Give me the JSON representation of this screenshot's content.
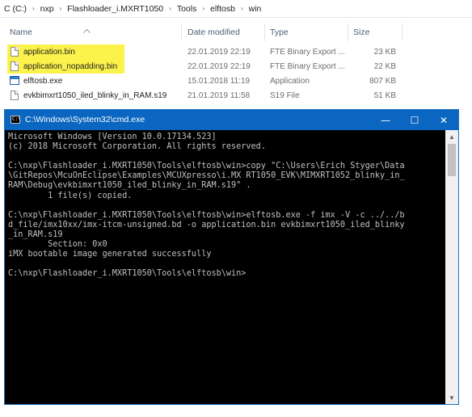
{
  "explorer": {
    "breadcrumb": [
      "C (C:)",
      "nxp",
      "Flashloader_i.MXRT1050",
      "Tools",
      "elftosb",
      "win"
    ],
    "breadcrumb_separator": "›",
    "columns": {
      "name": "Name",
      "date": "Date modified",
      "type": "Type",
      "size": "Size"
    },
    "sort_icon": "sort-up-chevron",
    "files": [
      {
        "name": "application.bin",
        "date": "22.01.2019 22:19",
        "type": "FTE Binary Export ...",
        "size": "23 KB",
        "icon": "file-icon",
        "highlighted": true
      },
      {
        "name": "application_nopadding.bin",
        "date": "22.01.2019 22:19",
        "type": "FTE Binary Export ...",
        "size": "22 KB",
        "icon": "file-icon",
        "highlighted": true
      },
      {
        "name": "elftosb.exe",
        "date": "15.01.2018 11:19",
        "type": "Application",
        "size": "807 KB",
        "icon": "exe-icon",
        "highlighted": false
      },
      {
        "name": "evkbimxrt1050_iled_blinky_in_RAM.s19",
        "date": "21.01.2019 11:58",
        "type": "S19 File",
        "size": "51 KB",
        "icon": "file-icon",
        "highlighted": false
      }
    ],
    "highlight_color": "#fbf24b"
  },
  "cmd": {
    "title": "C:\\Windows\\System32\\cmd.exe",
    "icon_label": "C:\\",
    "buttons": {
      "minimize": "—",
      "maximize": "☐",
      "close": "✕"
    },
    "titlebar_color": "#0a66c0",
    "lines": [
      "Microsoft Windows [Version 10.0.17134.523]",
      "(c) 2018 Microsoft Corporation. All rights reserved.",
      "",
      "C:\\nxp\\Flashloader_i.MXRT1050\\Tools\\elftosb\\win>copy \"C:\\Users\\Erich Styger\\Data",
      "\\GitRepos\\McuOnEclipse\\Examples\\MCUXpresso\\i.MX RT1050_EVK\\MIMXRT1052_blinky_in_",
      "RAM\\Debug\\evkbimxrt1050_iled_blinky_in_RAM.s19\" .",
      "        1 file(s) copied.",
      "",
      "C:\\nxp\\Flashloader_i.MXRT1050\\Tools\\elftosb\\win>elftosb.exe -f imx -V -c ../../b",
      "d_file/imx10xx/imx-itcm-unsigned.bd -o application.bin evkbimxrt1050_iled_blinky",
      "_in_RAM.s19",
      "        Section: 0x0",
      "iMX bootable image generated successfully",
      "",
      "C:\\nxp\\Flashloader_i.MXRT1050\\Tools\\elftosb\\win>"
    ],
    "scroll_up": "▲",
    "scroll_down": "▼"
  }
}
